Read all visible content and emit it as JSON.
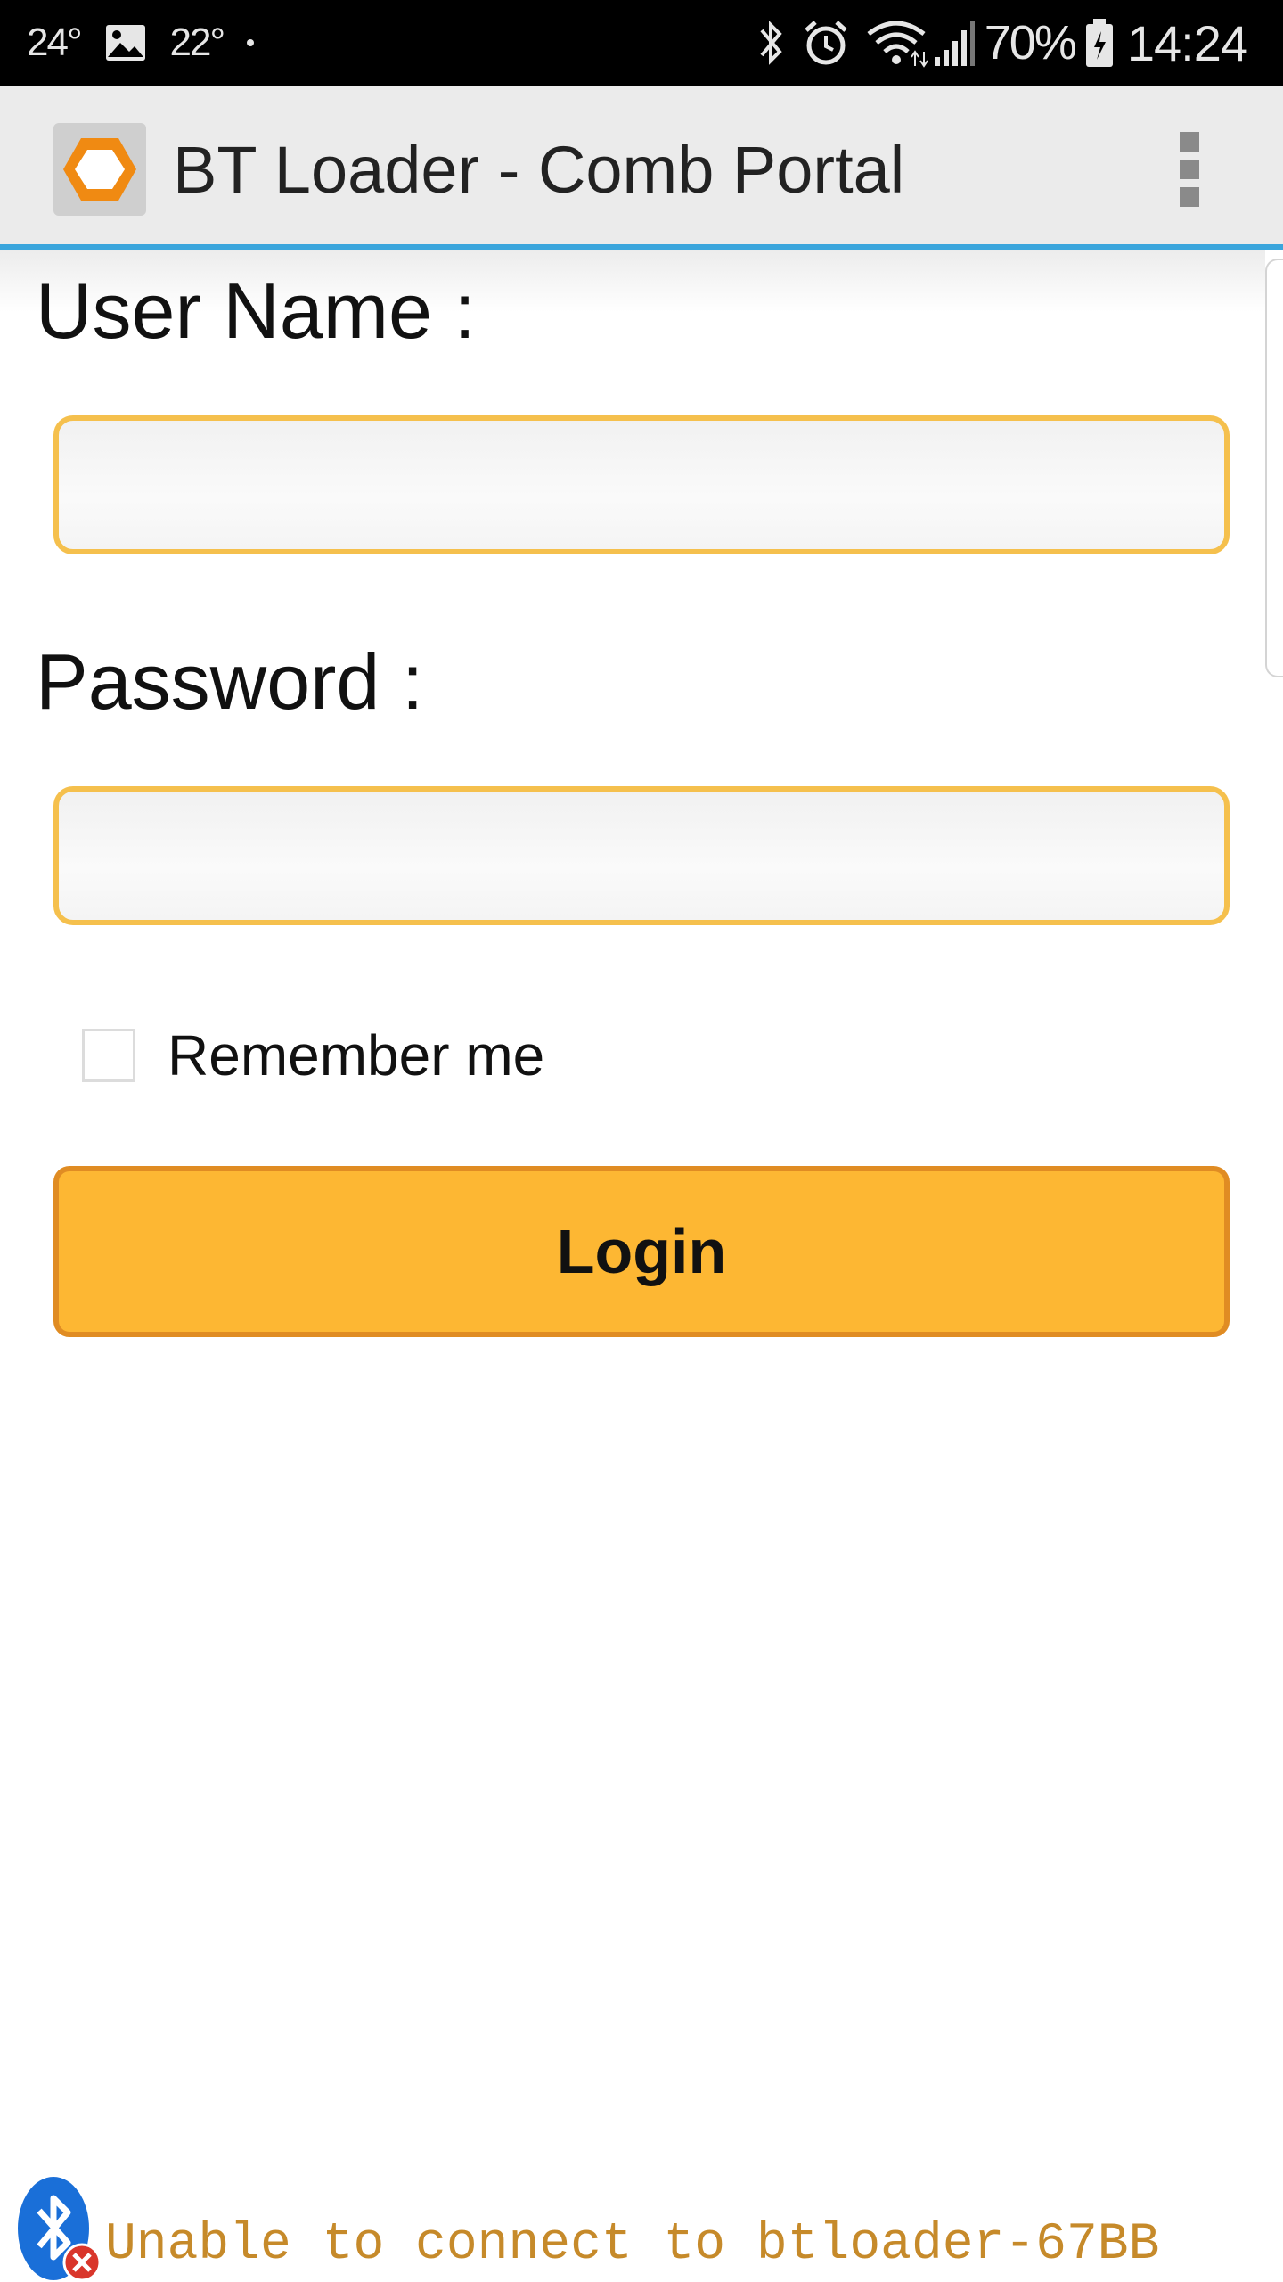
{
  "status_bar": {
    "temp_1": "24°",
    "temp_2": "22°",
    "battery_percent": "70%",
    "time": "14:24",
    "icons": [
      "gallery-icon",
      "bluetooth-icon",
      "alarm-icon",
      "wifi-icon",
      "signal-icon",
      "battery-icon"
    ]
  },
  "app_bar": {
    "title": "BT Loader - Comb Portal",
    "app_icon": "hexagon-logo-icon",
    "menu_icon": "overflow-menu-icon"
  },
  "form": {
    "username_label": "User Name :",
    "username_value": "",
    "password_label": "Password :",
    "password_value": "",
    "remember_label": "Remember me",
    "remember_checked": false,
    "login_label": "Login"
  },
  "connection": {
    "message": "Unable to connect to btloader-67BB",
    "icon": "bluetooth-disconnected-icon"
  },
  "colors": {
    "field_border": "#f5c04d",
    "button_fill": "#fdb733",
    "button_border": "#e08c23",
    "accent_line": "#3aa5dc",
    "status_text": "#c68a2a"
  }
}
